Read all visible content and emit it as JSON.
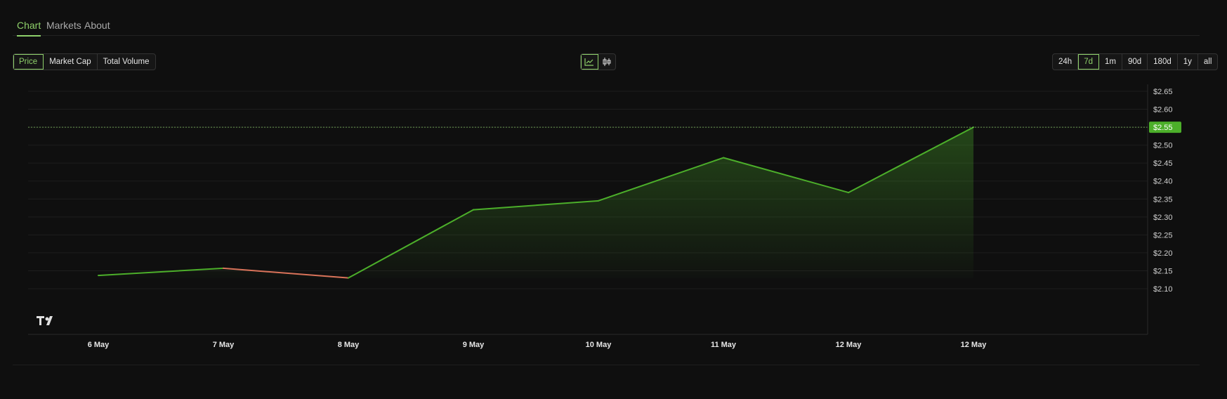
{
  "tabs": [
    {
      "label": "Chart"
    },
    {
      "label": "Markets"
    },
    {
      "label": "About"
    }
  ],
  "metric_buttons": [
    {
      "label": "Price",
      "active": true
    },
    {
      "label": "Market Cap",
      "active": false
    },
    {
      "label": "Total Volume",
      "active": false
    }
  ],
  "chart_mode_buttons": [
    {
      "icon": "line-chart-icon",
      "active": true
    },
    {
      "icon": "candlestick-icon",
      "active": false
    }
  ],
  "range_buttons": [
    {
      "label": "24h",
      "active": false
    },
    {
      "label": "7d",
      "active": true
    },
    {
      "label": "1m",
      "active": false
    },
    {
      "label": "90d",
      "active": false
    },
    {
      "label": "180d",
      "active": false
    },
    {
      "label": "1y",
      "active": false
    },
    {
      "label": "all",
      "active": false
    }
  ],
  "colors": {
    "accent": "#8ed06a",
    "up": "#4caf2a",
    "down": "#d9735a",
    "background": "#0f0f0f"
  },
  "chart_data": {
    "type": "line",
    "x_labels": [
      "6 May",
      "7 May",
      "8 May",
      "9 May",
      "10 May",
      "11 May",
      "12 May",
      "12 May"
    ],
    "values": [
      2.137,
      2.157,
      2.13,
      2.32,
      2.345,
      2.465,
      2.368,
      2.55
    ],
    "segment_colors": [
      "up",
      "down",
      "up",
      "up",
      "up",
      "down",
      "up"
    ],
    "y_ticks": [
      "$2.65",
      "$2.60",
      "$2.55",
      "$2.50",
      "$2.45",
      "$2.40",
      "$2.35",
      "$2.30",
      "$2.25",
      "$2.20",
      "$2.15",
      "$2.10"
    ],
    "ylim": [
      2.1,
      2.65
    ],
    "current_price_label": "$2.55",
    "current_price": 2.55,
    "grid": true,
    "watermark": "TradingView logo"
  }
}
